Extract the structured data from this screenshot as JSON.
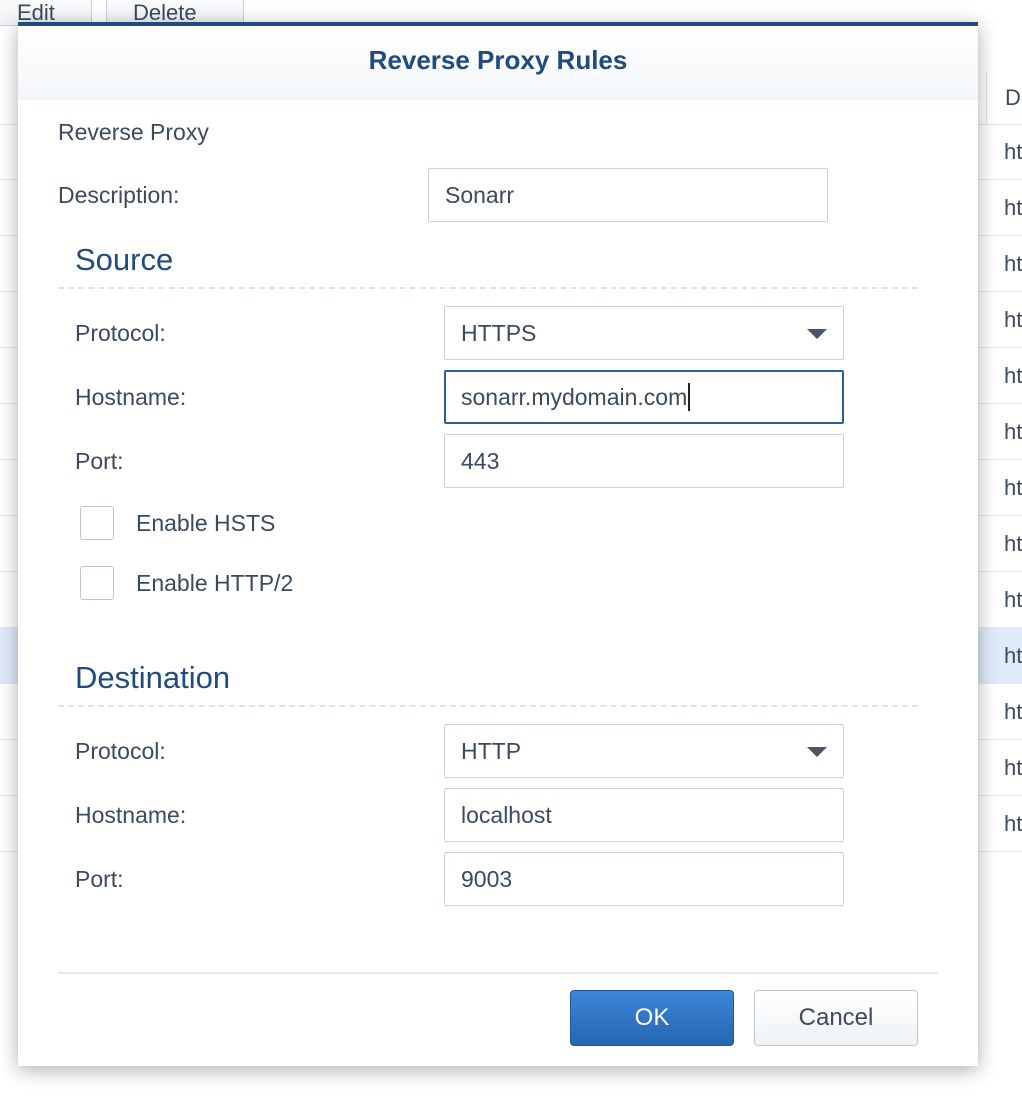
{
  "background": {
    "toolbar": {
      "edit_label": "Edit",
      "delete_label": "Delete"
    },
    "table": {
      "header_cell": "D",
      "rows": [
        "ht",
        "ht",
        "ht",
        "ht",
        "ht",
        "ht",
        "ht",
        "ht",
        "ht",
        "ht",
        "ht",
        "ht",
        "ht"
      ],
      "selected_row_index": 9
    }
  },
  "dialog": {
    "title": "Reverse Proxy Rules",
    "subtitle": "Reverse Proxy",
    "description": {
      "label": "Description:",
      "value": "Sonarr"
    },
    "source": {
      "heading": "Source",
      "protocol": {
        "label": "Protocol:",
        "value": "HTTPS"
      },
      "hostname": {
        "label": "Hostname:",
        "value": "sonarr.mydomain.com"
      },
      "port": {
        "label": "Port:",
        "value": "443"
      },
      "enable_hsts": {
        "label": "Enable HSTS",
        "checked": false
      },
      "enable_http2": {
        "label": "Enable HTTP/2",
        "checked": false
      }
    },
    "destination": {
      "heading": "Destination",
      "protocol": {
        "label": "Protocol:",
        "value": "HTTP"
      },
      "hostname": {
        "label": "Hostname:",
        "value": "localhost"
      },
      "port": {
        "label": "Port:",
        "value": "9003"
      }
    },
    "buttons": {
      "ok": "OK",
      "cancel": "Cancel"
    }
  },
  "colors": {
    "title": "#214b7d",
    "primary_button": "#2a6fc0",
    "selected_row": "#dfeafa"
  }
}
